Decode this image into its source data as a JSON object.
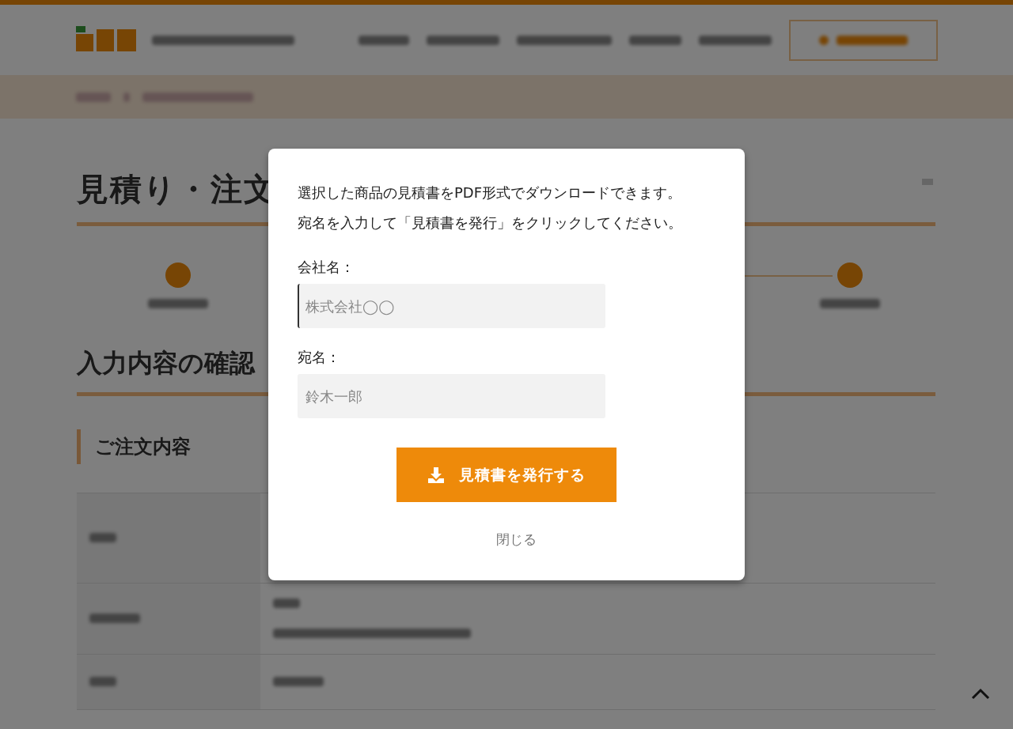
{
  "page": {
    "title": "見積り・注文",
    "sections": [
      {
        "kind": "heading",
        "text": "入力内容の確認"
      },
      {
        "kind": "subheading",
        "text": "ご注文内容"
      }
    ]
  },
  "modal": {
    "message_lines": [
      "選択した商品の見積書をPDF形式でダウンロードできます。",
      "宛名を入力して「見積書を発行」をクリックしてください。"
    ],
    "fields": [
      {
        "label": "会社名：",
        "placeholder": "株式会社◯◯",
        "focused": true
      },
      {
        "label": "宛名：",
        "placeholder": "鈴木一郎",
        "focused": false
      }
    ],
    "submit_button": "見積書を発行する",
    "close_link": "閉じる"
  }
}
